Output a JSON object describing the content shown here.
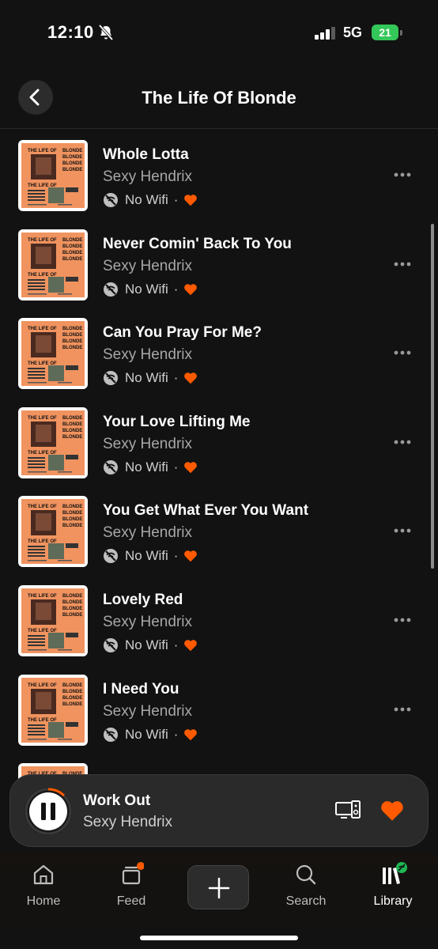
{
  "status": {
    "time": "12:10",
    "network": "5G",
    "battery": "21"
  },
  "header": {
    "title": "The Life Of Blonde"
  },
  "songs": [
    {
      "title": "Whole Lotta",
      "artist": "Sexy Hendrix",
      "source": "No Wifi"
    },
    {
      "title": "Never Comin' Back To You",
      "artist": "Sexy Hendrix",
      "source": "No Wifi"
    },
    {
      "title": "Can You Pray For Me?",
      "artist": "Sexy Hendrix",
      "source": "No Wifi"
    },
    {
      "title": "Your Love Lifting Me",
      "artist": "Sexy Hendrix",
      "source": "No Wifi"
    },
    {
      "title": "You Get What Ever You Want",
      "artist": "Sexy Hendrix",
      "source": "No Wifi"
    },
    {
      "title": "Lovely Red",
      "artist": "Sexy Hendrix",
      "source": "No Wifi"
    },
    {
      "title": "I Need You",
      "artist": "Sexy Hendrix",
      "source": "No Wifi"
    }
  ],
  "cover_text": {
    "left": "THE LIFE OF",
    "right": "BLONDE",
    "bottom": "THE LIFE OF"
  },
  "now_playing": {
    "title": "Work Out",
    "artist": "Sexy Hendrix"
  },
  "tabs": [
    {
      "label": "Home",
      "icon": "home-icon"
    },
    {
      "label": "Feed",
      "icon": "feed-icon"
    },
    {
      "label": "",
      "icon": "plus-icon"
    },
    {
      "label": "Search",
      "icon": "search-icon"
    },
    {
      "label": "Library",
      "icon": "library-icon"
    }
  ],
  "colors": {
    "accent": "#ff5a00",
    "background": "#121212",
    "battery": "#34c759",
    "cover": "#f0935f"
  }
}
